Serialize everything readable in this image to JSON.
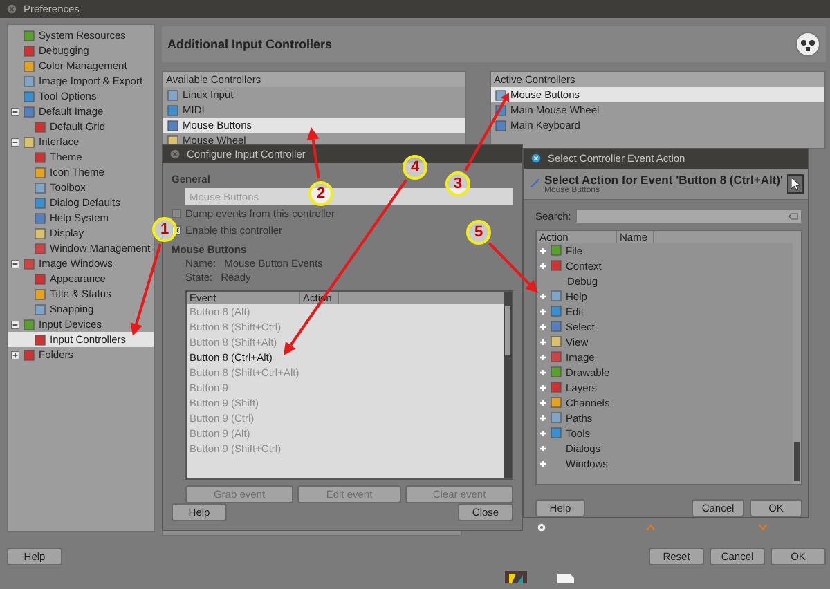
{
  "window": {
    "title": "Preferences"
  },
  "sidebar": {
    "items": [
      {
        "label": "System Resources",
        "selected": false
      },
      {
        "label": "Debugging",
        "selected": false
      },
      {
        "label": "Color Management",
        "selected": false
      },
      {
        "label": "Image Import & Export",
        "selected": false
      },
      {
        "label": "Tool Options",
        "selected": false
      },
      {
        "label": "Default Image",
        "selected": false,
        "expanded": true,
        "children": [
          {
            "label": "Default Grid",
            "selected": false
          }
        ]
      },
      {
        "label": "Interface",
        "selected": false,
        "expanded": true,
        "children": [
          {
            "label": "Theme",
            "selected": false
          },
          {
            "label": "Icon Theme",
            "selected": false
          },
          {
            "label": "Toolbox",
            "selected": false
          },
          {
            "label": "Dialog Defaults",
            "selected": false
          },
          {
            "label": "Help System",
            "selected": false
          },
          {
            "label": "Display",
            "selected": false
          },
          {
            "label": "Window Management",
            "selected": false
          }
        ]
      },
      {
        "label": "Image Windows",
        "selected": false,
        "expanded": true,
        "children": [
          {
            "label": "Appearance",
            "selected": false
          },
          {
            "label": "Title & Status",
            "selected": false
          },
          {
            "label": "Snapping",
            "selected": false
          }
        ]
      },
      {
        "label": "Input Devices",
        "selected": false,
        "expanded": true,
        "children": [
          {
            "label": "Input Controllers",
            "selected": true
          }
        ]
      },
      {
        "label": "Folders",
        "selected": false,
        "expanded": false
      }
    ]
  },
  "page": {
    "title": "Additional Input Controllers"
  },
  "available_controllers": {
    "header": "Available Controllers",
    "items": [
      {
        "label": "Linux Input",
        "selected": false
      },
      {
        "label": "MIDI",
        "selected": false
      },
      {
        "label": "Mouse Buttons",
        "selected": true
      },
      {
        "label": "Mouse Wheel",
        "selected": false
      }
    ]
  },
  "active_controllers": {
    "header": "Active Controllers",
    "items": [
      {
        "label": "Mouse Buttons",
        "selected": true
      },
      {
        "label": "Main Mouse Wheel",
        "selected": false
      },
      {
        "label": "Main Keyboard",
        "selected": false
      }
    ]
  },
  "configure_dialog": {
    "title": "Configure Input Controller",
    "section": "General",
    "name_value": "Mouse Buttons",
    "checkboxes": [
      {
        "label": "Dump events from this controller",
        "checked": false
      },
      {
        "label": "Enable this controller",
        "checked": true
      }
    ],
    "info_heading": "Mouse Buttons",
    "info": [
      {
        "label": "Name:",
        "value": "Mouse Button Events"
      },
      {
        "label": "State:",
        "value": "Ready"
      }
    ],
    "columns": [
      "Event",
      "Action"
    ],
    "rows": [
      {
        "event": "Button 8 (Alt)",
        "assigned": false
      },
      {
        "event": "Button 8 (Shift+Ctrl)",
        "assigned": false
      },
      {
        "event": "Button 8 (Shift+Alt)",
        "assigned": false
      },
      {
        "event": "Button 8 (Ctrl+Alt)",
        "assigned": true
      },
      {
        "event": "Button 8 (Shift+Ctrl+Alt)",
        "assigned": false
      },
      {
        "event": "Button 9",
        "assigned": false
      },
      {
        "event": "Button 9 (Shift)",
        "assigned": false
      },
      {
        "event": "Button 9 (Ctrl)",
        "assigned": false
      },
      {
        "event": "Button 9 (Alt)",
        "assigned": false
      },
      {
        "event": "Button 9 (Shift+Ctrl)",
        "assigned": false
      }
    ],
    "event_buttons": [
      {
        "label": "Grab event",
        "disabled": true
      },
      {
        "label": "Edit event",
        "disabled": true
      },
      {
        "label": "Clear event",
        "disabled": true
      }
    ],
    "buttons": [
      "Help",
      "Close"
    ]
  },
  "select_dialog": {
    "title": "Select Controller Event Action",
    "heading": "Select Action for Event 'Button 8 (Ctrl+Alt)'",
    "subheading": "Mouse Buttons",
    "search_label": "Search:",
    "columns": [
      "Action",
      "Name"
    ],
    "actions": [
      {
        "label": "File",
        "expandable": true
      },
      {
        "label": "Context",
        "expandable": true
      },
      {
        "label": "Debug",
        "expandable": false
      },
      {
        "label": "Help",
        "expandable": true
      },
      {
        "label": "Edit",
        "expandable": true
      },
      {
        "label": "Select",
        "expandable": true
      },
      {
        "label": "View",
        "expandable": true
      },
      {
        "label": "Image",
        "expandable": true
      },
      {
        "label": "Drawable",
        "expandable": true
      },
      {
        "label": "Layers",
        "expandable": true
      },
      {
        "label": "Channels",
        "expandable": true
      },
      {
        "label": "Paths",
        "expandable": true
      },
      {
        "label": "Tools",
        "expandable": true
      },
      {
        "label": "Dialogs",
        "expandable": true
      },
      {
        "label": "Windows",
        "expandable": true
      }
    ],
    "buttons_left": [
      "Help"
    ],
    "buttons_right": [
      "Cancel",
      "OK"
    ]
  },
  "callouts": [
    "1",
    "2",
    "3",
    "4",
    "5"
  ],
  "footer": {
    "left_buttons": [
      "Help"
    ],
    "right_buttons": [
      "Reset",
      "Cancel",
      "OK"
    ]
  }
}
